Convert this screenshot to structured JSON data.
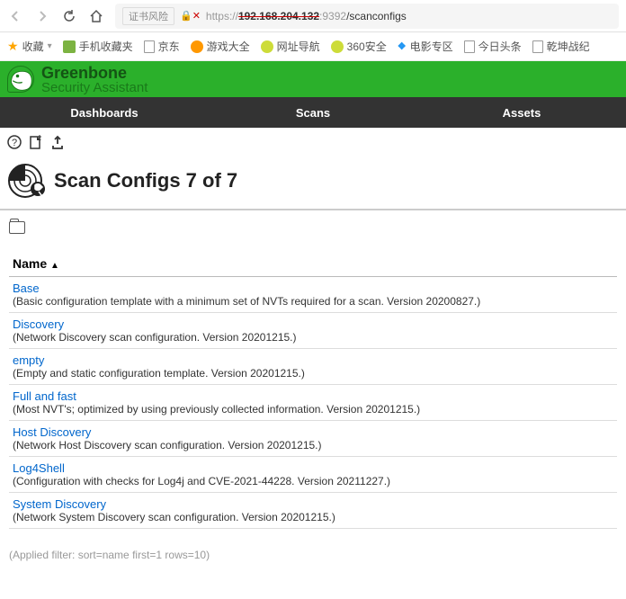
{
  "browser": {
    "cert_warning": "证书风险",
    "url_scheme": "https://",
    "url_host": "192.168.204.132",
    "url_port": ":9392",
    "url_path": "/scanconfigs"
  },
  "bookmarks": {
    "fav": "收藏",
    "items": [
      {
        "label": "手机收藏夹",
        "icon": "green"
      },
      {
        "label": "京东",
        "icon": "page"
      },
      {
        "label": "游戏大全",
        "icon": "orange-circ"
      },
      {
        "label": "网址导航",
        "icon": "ygreen-circ"
      },
      {
        "label": "360安全",
        "icon": "ygreen-circ"
      },
      {
        "label": "电影专区",
        "icon": "blue-txt"
      },
      {
        "label": "今日头条",
        "icon": "page"
      },
      {
        "label": "乾坤战纪",
        "icon": "page"
      }
    ]
  },
  "header": {
    "name": "Greenbone",
    "subtitle": "Security Assistant"
  },
  "nav": {
    "items": [
      "Dashboards",
      "Scans",
      "Assets"
    ]
  },
  "page": {
    "title": "Scan Configs 7 of 7"
  },
  "table": {
    "col_name": "Name",
    "sort_arrow": "▲",
    "rows": [
      {
        "name": "Base",
        "desc": "(Basic configuration template with a minimum set of NVTs required for a scan. Version 20200827.)"
      },
      {
        "name": "Discovery",
        "desc": "(Network Discovery scan configuration. Version 20201215.)"
      },
      {
        "name": "empty",
        "desc": "(Empty and static configuration template. Version 20201215.)"
      },
      {
        "name": "Full and fast",
        "desc": "(Most NVT's; optimized by using previously collected information. Version 20201215.)"
      },
      {
        "name": "Host Discovery",
        "desc": "(Network Host Discovery scan configuration. Version 20201215.)"
      },
      {
        "name": "Log4Shell",
        "desc": "(Configuration with checks for Log4j and CVE-2021-44228. Version 20211227.)"
      },
      {
        "name": "System Discovery",
        "desc": "(Network System Discovery scan configuration. Version 20201215.)"
      }
    ]
  },
  "filter_text": "(Applied filter: sort=name first=1 rows=10)"
}
